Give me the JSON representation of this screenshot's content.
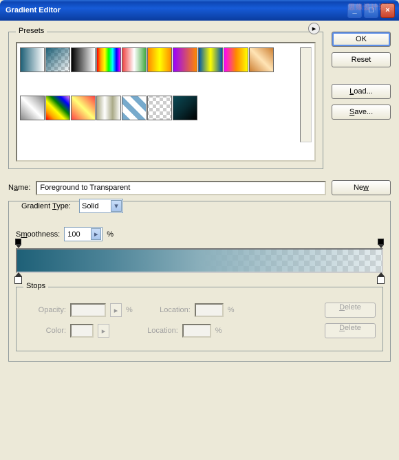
{
  "window_title": "Gradient Editor",
  "buttons": {
    "ok": "OK",
    "reset": "Reset",
    "load": "Load...",
    "save": "Save...",
    "new": "New"
  },
  "presets_label": "Presets",
  "name_label_pre": "N",
  "name_label_u": "a",
  "name_label_post": "me:",
  "name_value": "Foreground to Transparent",
  "gradient_type_pre": "Gradient ",
  "gradient_type_u": "T",
  "gradient_type_post": "ype:",
  "type_value": "Solid",
  "smoothness_pre": "S",
  "smoothness_u": "m",
  "smoothness_post": "oothness:",
  "smoothness_value": "100",
  "percent": "%",
  "stops_label": "Stops",
  "stops": {
    "opacity": "Opacity:",
    "color": "Color:",
    "location": "Location:",
    "delete": "Delete",
    "delete_u": "D",
    "delete_rest": "elete"
  },
  "watermark": "思缘设计论坛"
}
